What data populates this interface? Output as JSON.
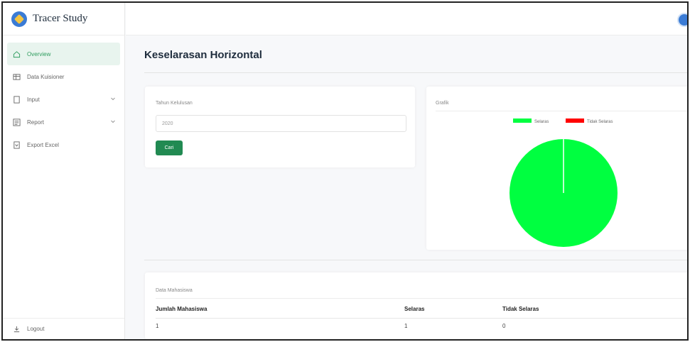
{
  "brand": {
    "title": "Tracer Study"
  },
  "sidebar": {
    "items": [
      {
        "label": "Overview",
        "icon": "home-icon",
        "active": true
      },
      {
        "label": "Data Kuisioner",
        "icon": "table-icon"
      },
      {
        "label": "Input",
        "icon": "file-icon",
        "has_submenu": true
      },
      {
        "label": "Report",
        "icon": "report-icon",
        "has_submenu": true
      },
      {
        "label": "Export Excel",
        "icon": "export-icon"
      }
    ],
    "logout": "Logout"
  },
  "page": {
    "title": "Keselarasan Horizontal"
  },
  "search": {
    "label": "Tahun Kelulusan",
    "value": "2020",
    "button": "Cari"
  },
  "chart": {
    "label": "Grafik",
    "accent_green": "#00ff40",
    "accent_red": "#ff0000"
  },
  "chart_data": {
    "type": "pie",
    "labels": [
      "Selaras",
      "Tidak Selaras"
    ],
    "values": [
      1,
      0
    ],
    "colors": [
      "#00ff40",
      "#ff0000"
    ],
    "legend": "top"
  },
  "table": {
    "label": "Data Mahasiswa",
    "headers": [
      "Jumlah Mahasiswa",
      "Selaras",
      "Tidak Selaras"
    ],
    "rows": [
      [
        "1",
        "1",
        "0"
      ]
    ]
  },
  "colors": {
    "primary_button": "#218a52",
    "active_nav_bg": "#e8f4ee",
    "active_nav_text": "#2e9c5e"
  }
}
